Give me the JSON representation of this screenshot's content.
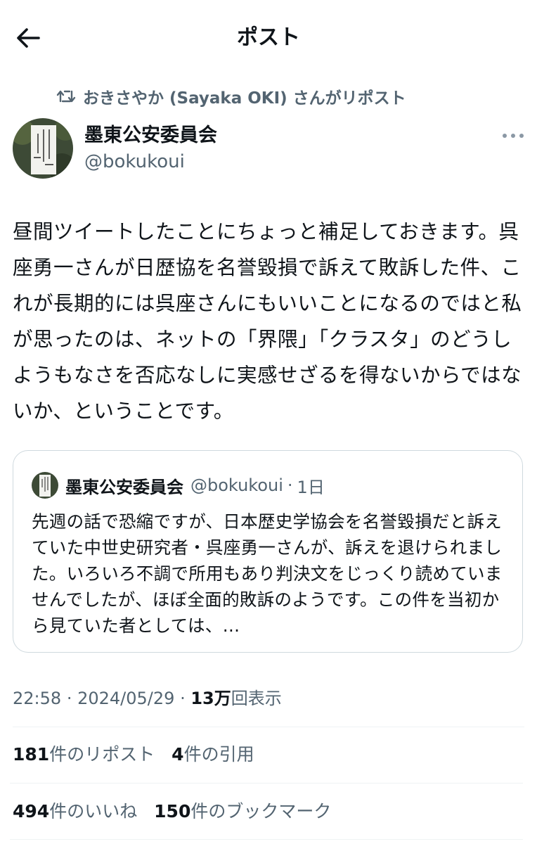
{
  "header": {
    "title": "ポスト",
    "back_icon": "arrow-left-icon"
  },
  "repost": {
    "text": "おきさやか (Sayaka OKI) さんがリポスト",
    "icon": "repost-icon"
  },
  "author": {
    "name": "墨東公安委員会",
    "handle": "@bokukoui"
  },
  "tweet": {
    "text": "昼間ツイートしたことにちょっと補足しておきます。呉座勇一さんが日歴協を名誉毀損で訴えて敗訴した件、これが長期的には呉座さんにもいいことになるのではと私が思ったのは、ネットの「界隈」「クラスタ」のどうしようもなさを否応なしに実感せざるを得ないからではないか、ということです。"
  },
  "quote": {
    "name": "墨東公安委員会",
    "handle": "@bokukoui",
    "separator": "·",
    "age": "1日",
    "text": "先週の話で恐縮ですが、日本歴史学協会を名誉毀損だと訴えていた中世史研究者・呉座勇一さんが、訴えを退けられました。いろいろ不調で所用もあり判決文をじっくり読めていませんでしたが、ほぼ全面的敗訴のようです。この件を当初から見ていた者としては、…"
  },
  "meta": {
    "time": "22:58",
    "sep1": "·",
    "date": "2024/05/29",
    "sep2": "·",
    "views_count": "13万",
    "views_label": "回表示"
  },
  "stats": {
    "reposts_count": "181",
    "reposts_label": "件のリポスト",
    "quotes_count": "4",
    "quotes_label": "件の引用",
    "likes_count": "494",
    "likes_label": "件のいいね",
    "bookmarks_count": "150",
    "bookmarks_label": "件のブックマーク"
  },
  "colors": {
    "text": "#0f1419",
    "secondary": "#536471",
    "border": "#cfd9de",
    "divider": "#eff3f4"
  }
}
